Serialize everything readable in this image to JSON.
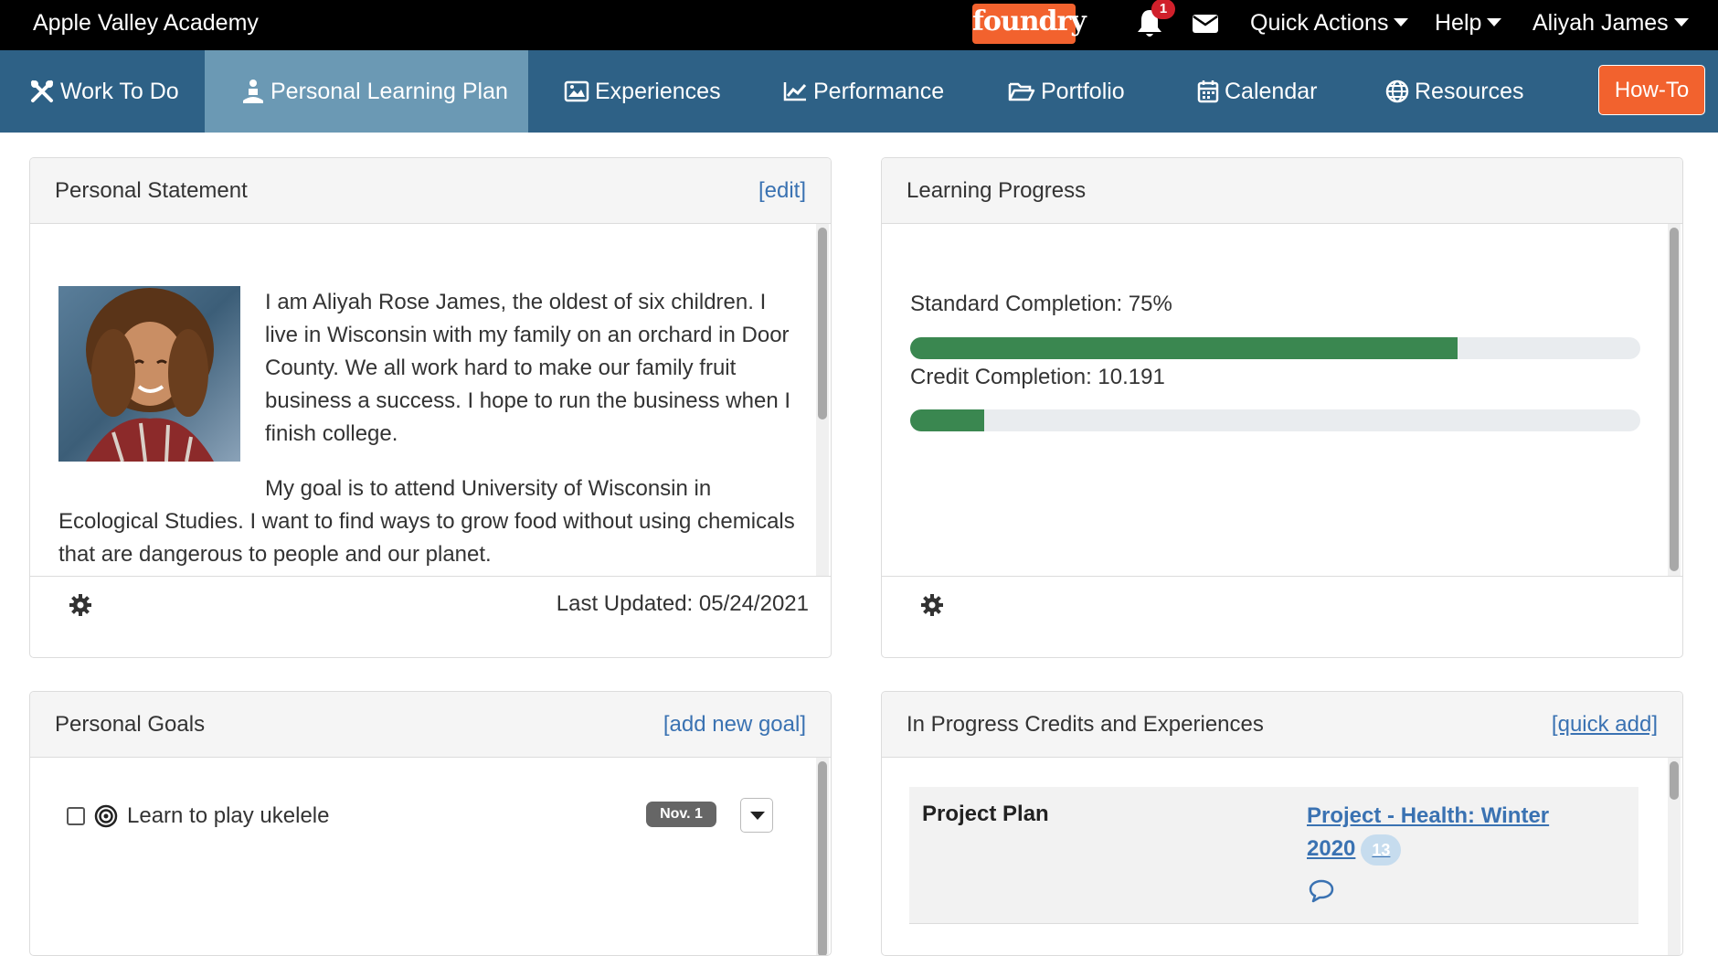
{
  "topbar": {
    "school": "Apple Valley Academy",
    "logo_text": "foundry",
    "notification_count": "1",
    "quick_actions": "Quick Actions",
    "help": "Help",
    "user": "Aliyah James"
  },
  "nav": {
    "items": [
      {
        "label": "Work To Do",
        "icon": "tools-icon"
      },
      {
        "label": "Personal Learning Plan",
        "icon": "person-meditate-icon"
      },
      {
        "label": "Experiences",
        "icon": "image-icon"
      },
      {
        "label": "Performance",
        "icon": "line-chart-icon"
      },
      {
        "label": "Portfolio",
        "icon": "folder-open-icon"
      },
      {
        "label": "Calendar",
        "icon": "calendar-icon"
      },
      {
        "label": "Resources",
        "icon": "globe-icon"
      }
    ],
    "active": "Personal Learning Plan",
    "howto": "How-To"
  },
  "personal_statement": {
    "title": "Personal Statement",
    "edit": "[edit]",
    "paragraph1": "I am Aliyah Rose James, the oldest of six children. I live in Wisconsin with my family on an orchard in Door County. We all work hard to make our family fruit business a success. I hope to run the business when I finish college.",
    "paragraph2": "My goal is to attend University of Wisconsin in Ecological Studies. I want to find ways to grow food without using chemicals that are dangerous to people and our planet.",
    "last_updated": "Last Updated: 05/24/2021"
  },
  "learning_progress": {
    "title": "Learning Progress",
    "standard_label": "Standard Completion: 75%",
    "standard_fraction": 0.75,
    "credit_label": "Credit Completion: 10.191",
    "credit_fraction": 0.102
  },
  "personal_goals": {
    "title": "Personal Goals",
    "add": "[add new goal]",
    "goals": [
      {
        "label": "Learn to play ukelele",
        "date": "Nov. 1"
      }
    ]
  },
  "in_progress": {
    "title": "In Progress Credits and Experiences",
    "quick_add": "[quick add]",
    "items": [
      {
        "type": "Project Plan",
        "link": "Project - Health: Winter 2020",
        "count": "13"
      }
    ]
  },
  "colors": {
    "nav_bg": "#2e6186",
    "nav_active": "#6b99b4",
    "accent_orange": "#f2622e",
    "progress_green": "#3a8750",
    "link_blue": "#3a72b2"
  }
}
